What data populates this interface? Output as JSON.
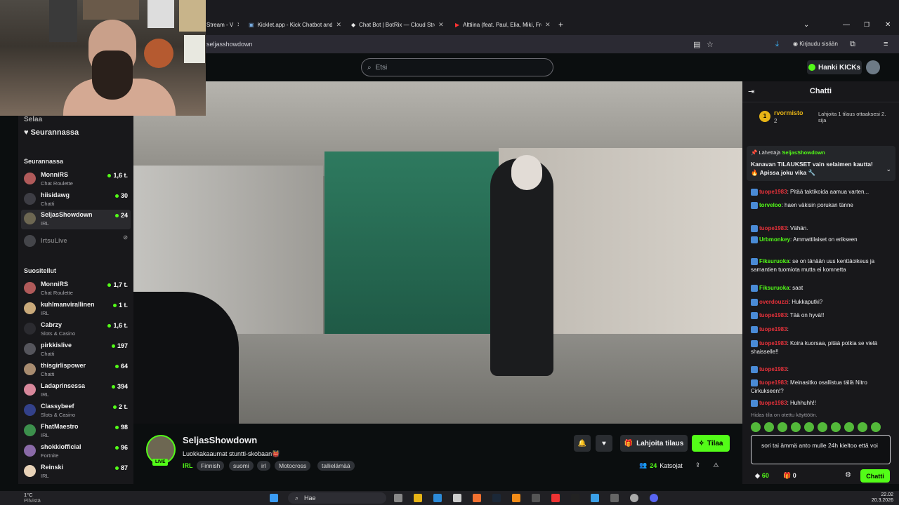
{
  "browser": {
    "tabs": [
      {
        "label": "Stream - V"
      },
      {
        "label": "Kicklet.app - Kick Chatbot and G"
      },
      {
        "label": "Chat Bot | BotRix — Cloud Strea"
      },
      {
        "label": "Alttiina (feat. Paul, Elia, Miki, Fre"
      }
    ],
    "url": "seljasshowdown",
    "signin_label": "Kirjaudu sisään"
  },
  "header": {
    "search_placeholder": "Etsi",
    "kicks_label": "Hanki KICKs"
  },
  "sidebar": {
    "browse_label": "Selaa",
    "following_nav_label": "Seurannassa",
    "following_title": "Seurannassa",
    "following": [
      {
        "name": "MonniRS",
        "category": "Chat Roulette",
        "viewers": "1,6 t."
      },
      {
        "name": "hiisidawg",
        "category": "Chatti",
        "viewers": "30"
      },
      {
        "name": "SeljasShowdown",
        "category": "IRL",
        "viewers": "24"
      },
      {
        "name": "IrtsuLive",
        "category": "",
        "viewers": ""
      }
    ],
    "recommended_title": "Suositellut",
    "recommended": [
      {
        "name": "MonniRS",
        "category": "Chat Roulette",
        "viewers": "1,7 t."
      },
      {
        "name": "kuhlmanvirallinen",
        "category": "IRL",
        "viewers": "1 t."
      },
      {
        "name": "Cabrzy",
        "category": "Slots & Casino",
        "viewers": "1,6 t."
      },
      {
        "name": "pirkkislive",
        "category": "Chatti",
        "viewers": "197"
      },
      {
        "name": "thisgirlispower",
        "category": "Chatti",
        "viewers": "64"
      },
      {
        "name": "Ladaprinsessa",
        "category": "IRL",
        "viewers": "394"
      },
      {
        "name": "Classybeef",
        "category": "Slots & Casino",
        "viewers": "2 t."
      },
      {
        "name": "FhatMaestro",
        "category": "IRL",
        "viewers": "98"
      },
      {
        "name": "shokkiofficial",
        "category": "Fortnite",
        "viewers": "96"
      },
      {
        "name": "Reinski",
        "category": "IRL",
        "viewers": "87"
      }
    ]
  },
  "stream": {
    "channel": "SeljasShowdown",
    "live_label": "LIVE",
    "title": "Luokkakaaumat stuntti-skobaan👹",
    "category": "IRL",
    "tags": [
      "Finnish",
      "suomi",
      "irl",
      "Motocross",
      "tallielämää"
    ],
    "gift_label": "Lahjoita tilaus",
    "subscribe_label": "Tilaa",
    "viewer_count": "24",
    "viewers_label": "Katsojat"
  },
  "chat": {
    "title": "Chatti",
    "top_gifter": {
      "rank": "1",
      "name": "rvormisto",
      "count": "2",
      "info": "Lahjoita 1 tilaus ottaaksesi 2. sija"
    },
    "pinned": {
      "sender_label": "Lähettäjä",
      "sender": "SeljasShowdown",
      "message": "Kanavan TILAUKSET vain selaimen kautta! 🔥 Apissa joku vika 🔧"
    },
    "messages": [
      {
        "user": "tuope1983",
        "color": "#e5313a",
        "text": "Pitää taktikoida aamua varten..."
      },
      {
        "user": "torveloo",
        "color": "#53fc18",
        "text": "haen väkisin porukan tänne"
      },
      {
        "user": "tuope1983",
        "color": "#e5313a",
        "text": "Vähän."
      },
      {
        "user": "Urbmonkey",
        "color": "#53fc18",
        "text": "Ammattilaiset on erikseen"
      },
      {
        "user": "Fiksuruoka",
        "color": "#53fc18",
        "text": "se on tänään uus kenttäoikeus ja samantien tuomiota mutta ei komnetta"
      },
      {
        "user": "Fiksuruoka",
        "color": "#53fc18",
        "text": "saat"
      },
      {
        "user": "overdouzzi",
        "color": "#e5313a",
        "text": "Hukkaputki?"
      },
      {
        "user": "tuope1983",
        "color": "#e5313a",
        "text": "Tää on hyvä!!"
      },
      {
        "user": "tuope1983",
        "color": "#e5313a",
        "text": ""
      },
      {
        "user": "tuope1983",
        "color": "#e5313a",
        "text": "Koira kuorsaa, pitää potkia se vielä shaisselle!!"
      },
      {
        "user": "tuope1983",
        "color": "#e5313a",
        "text": ""
      },
      {
        "user": "tuope1983",
        "color": "#e5313a",
        "text": "Meinasitko osallistua tällä Nitro Cirkukseen!?"
      },
      {
        "user": "tuope1983",
        "color": "#e5313a",
        "text": "Huhhuhh!!"
      }
    ],
    "slow_mode": "Hidas tila on otettu käyttöön.",
    "input_text": "sori tai ämmä anto mulle 24h kieltoo että voi",
    "points": "60",
    "gifts": "0",
    "send_label": "Chatti"
  },
  "taskbar": {
    "temperature": "1°C",
    "weather_desc": "Pilvistä",
    "search_label": "Hae",
    "time": "22.02",
    "date": "20.3.2026"
  }
}
